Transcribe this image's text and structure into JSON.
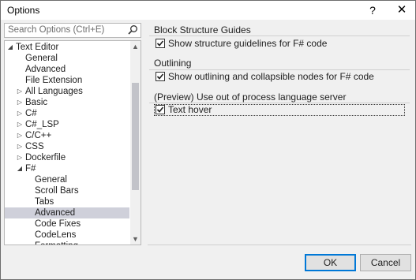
{
  "window": {
    "title": "Options",
    "help_glyph": "?",
    "close_glyph": "✕"
  },
  "search": {
    "placeholder": "Search Options (Ctrl+E)"
  },
  "tree": {
    "items": [
      {
        "label": "Text Editor",
        "level": 0,
        "expander": "expanded",
        "selected": false
      },
      {
        "label": "General",
        "level": 1,
        "expander": "none",
        "selected": false
      },
      {
        "label": "Advanced",
        "level": 1,
        "expander": "none",
        "selected": false
      },
      {
        "label": "File Extension",
        "level": 1,
        "expander": "none",
        "selected": false
      },
      {
        "label": "All Languages",
        "level": 1,
        "expander": "collapsed",
        "selected": false
      },
      {
        "label": "Basic",
        "level": 1,
        "expander": "collapsed",
        "selected": false
      },
      {
        "label": "C#",
        "level": 1,
        "expander": "collapsed",
        "selected": false
      },
      {
        "label": "C#_LSP",
        "level": 1,
        "expander": "collapsed",
        "selected": false
      },
      {
        "label": "C/C++",
        "level": 1,
        "expander": "collapsed",
        "selected": false
      },
      {
        "label": "CSS",
        "level": 1,
        "expander": "collapsed",
        "selected": false
      },
      {
        "label": "Dockerfile",
        "level": 1,
        "expander": "collapsed",
        "selected": false
      },
      {
        "label": "F#",
        "level": 1,
        "expander": "expanded",
        "selected": false
      },
      {
        "label": "General",
        "level": 2,
        "expander": "none",
        "selected": false
      },
      {
        "label": "Scroll Bars",
        "level": 2,
        "expander": "none",
        "selected": false
      },
      {
        "label": "Tabs",
        "level": 2,
        "expander": "none",
        "selected": false
      },
      {
        "label": "Advanced",
        "level": 2,
        "expander": "none",
        "selected": true
      },
      {
        "label": "Code Fixes",
        "level": 2,
        "expander": "none",
        "selected": false
      },
      {
        "label": "CodeLens",
        "level": 2,
        "expander": "none",
        "selected": false
      },
      {
        "label": "Formatting",
        "level": 2,
        "expander": "none",
        "selected": false
      }
    ]
  },
  "sections": {
    "block": {
      "header": "Block Structure Guides",
      "option": "Show structure guidelines for F# code",
      "checked": true
    },
    "outlining": {
      "header": "Outlining",
      "option": "Show outlining and collapsible nodes for F# code",
      "checked": true
    },
    "lsp": {
      "header": "(Preview) Use out of process language server",
      "option": "Text hover",
      "checked": true
    }
  },
  "buttons": {
    "ok": "OK",
    "cancel": "Cancel"
  },
  "colors": {
    "selection": "#cfd0da",
    "primary_border": "#0078d7"
  }
}
